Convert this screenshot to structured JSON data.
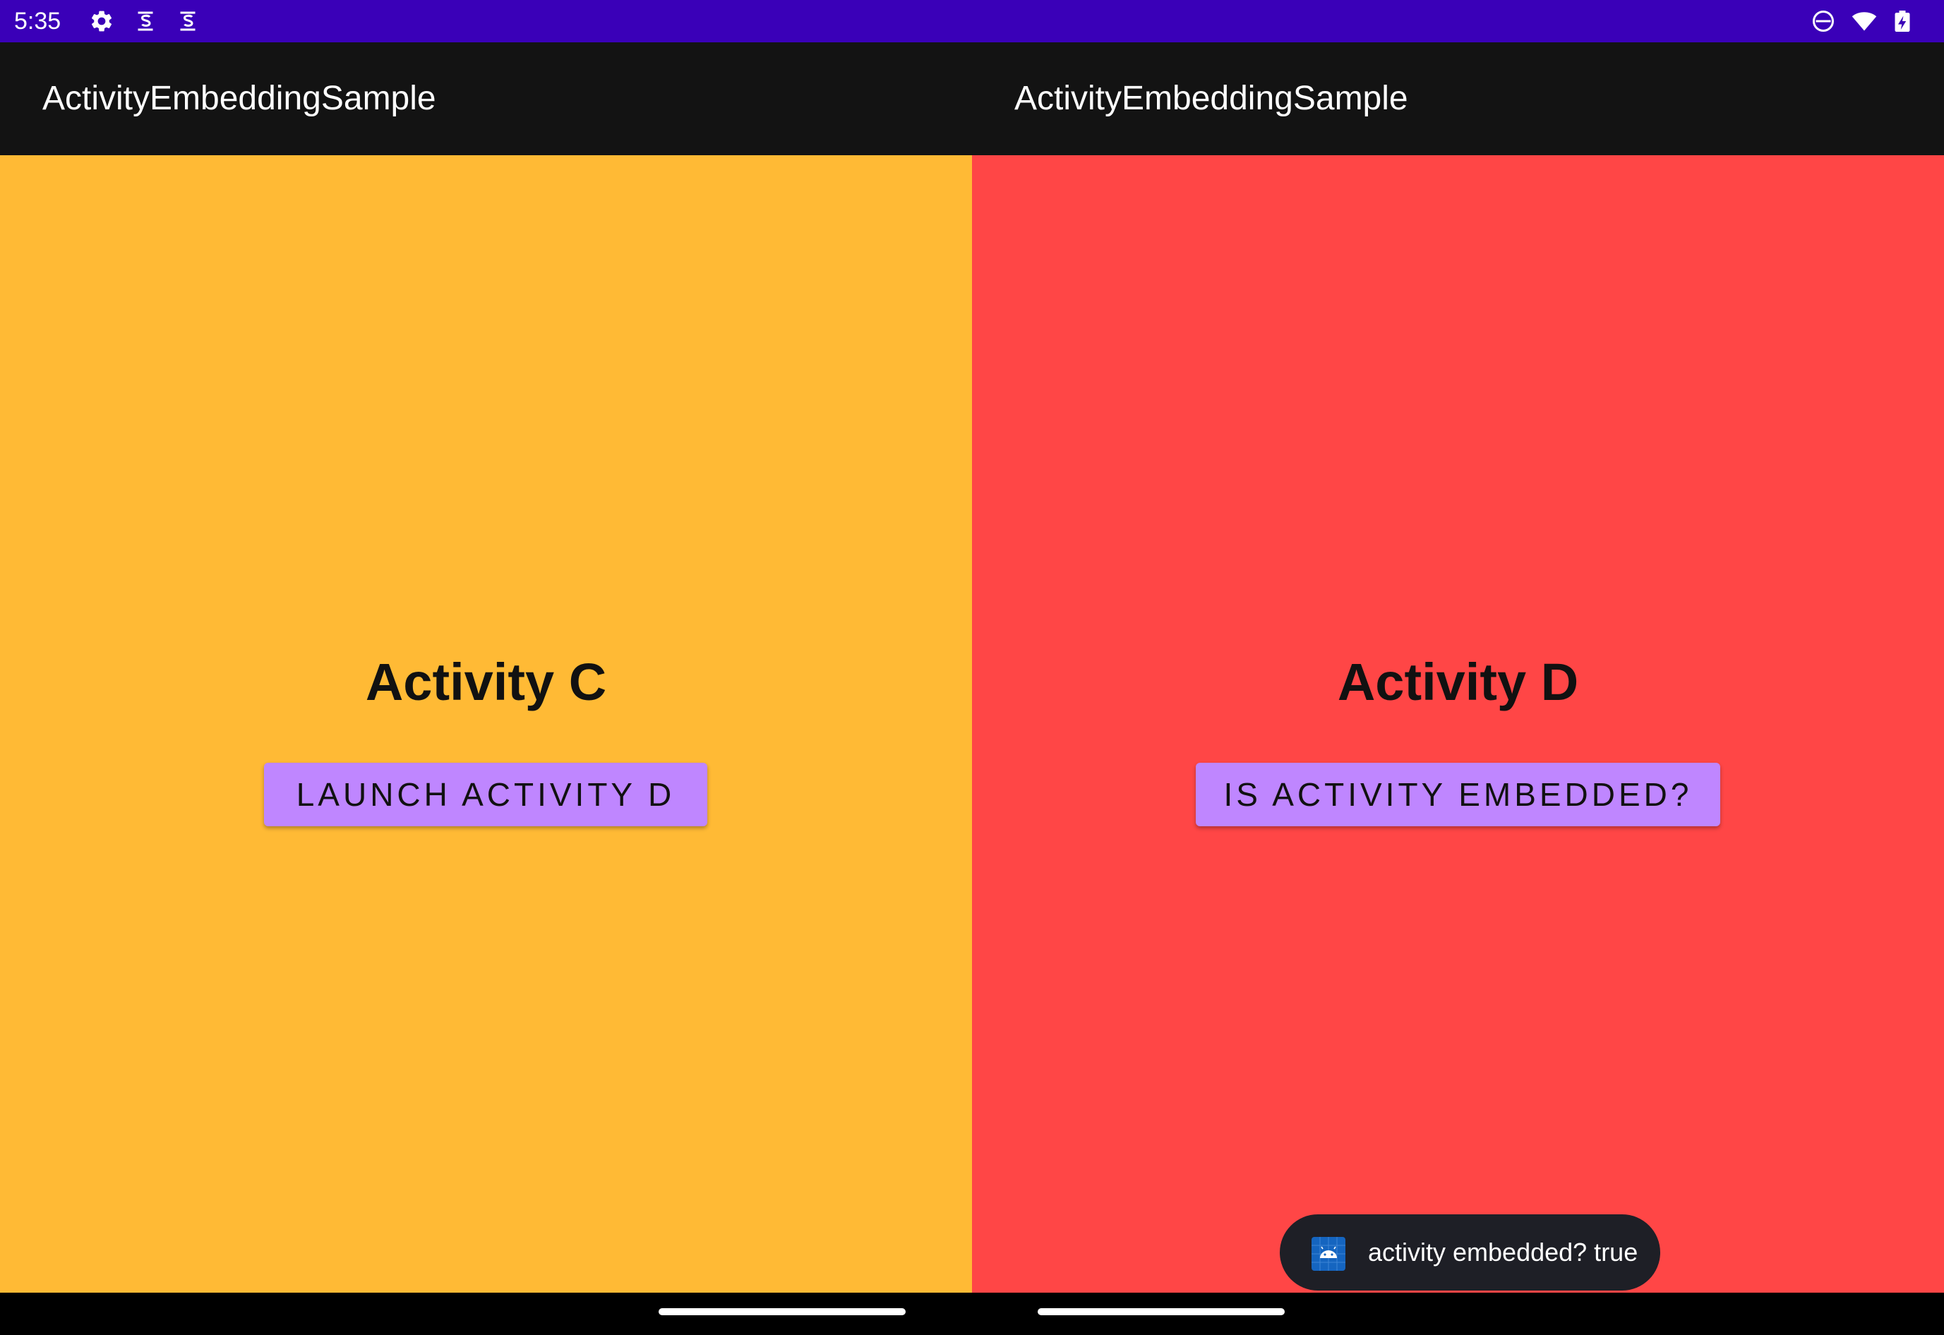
{
  "status_bar": {
    "time": "5:35",
    "left_icons": [
      "gear-icon",
      "s-badge-icon",
      "s-badge-icon"
    ],
    "right_icons": [
      "do-not-disturb-icon",
      "wifi-icon",
      "battery-charging-icon"
    ],
    "background": "#3a00b8"
  },
  "left_pane": {
    "app_title": "ActivityEmbeddingSample",
    "heading": "Activity C",
    "button_label": "LAUNCH ACTIVITY D",
    "background": "#ffba35"
  },
  "right_pane": {
    "app_title": "ActivityEmbeddingSample",
    "heading": "Activity D",
    "button_label": "IS ACTIVITY EMBEDDED?",
    "background": "#ff4646"
  },
  "toast": {
    "icon": "android-app-icon",
    "message": "activity embedded? true"
  },
  "colors": {
    "app_bar": "#131313",
    "button": "#bf86ff",
    "toast_bg": "#1e1f26"
  },
  "navigation": {
    "gesture_handles": [
      "left-pane-handle",
      "right-pane-handle"
    ]
  }
}
